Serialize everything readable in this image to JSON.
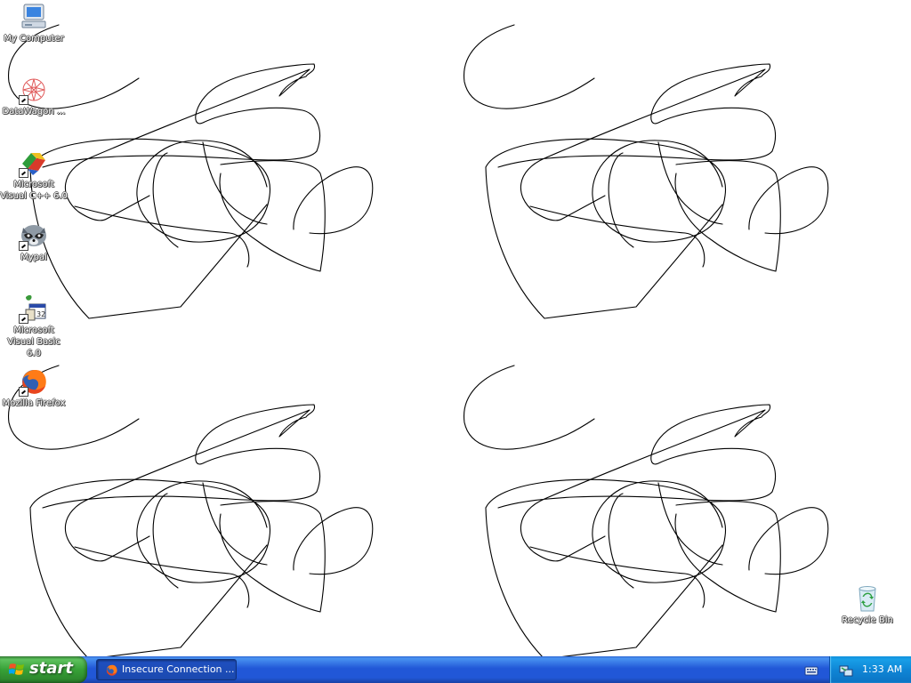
{
  "desktop": {
    "icons": [
      {
        "label": "My Computer",
        "icon": "my-computer-icon"
      },
      {
        "label": "DataWagon ...",
        "icon": "datawagon-icon"
      },
      {
        "label": "Microsoft Visual C++ 6.0",
        "icon": "visual-cpp-icon"
      },
      {
        "label": "Mypal",
        "icon": "mypal-raccoon-icon"
      },
      {
        "label": "Microsoft Visual Basic 6.0",
        "icon": "visual-basic-icon"
      },
      {
        "label": "Mozilla Firefox",
        "icon": "firefox-icon"
      }
    ],
    "recycle_bin": {
      "label": "Recycle Bin",
      "icon": "recycle-bin-icon"
    }
  },
  "taskbar": {
    "start_label": "start",
    "tasks": [
      {
        "label": "Insecure Connection ...",
        "icon": "firefox-icon"
      }
    ],
    "tray": {
      "time": "1:33 AM",
      "icons": [
        "keyboard-icon",
        "network-icon"
      ]
    }
  },
  "colors": {
    "taskbar_blue": "#2157d7",
    "start_green": "#37a137",
    "tray_blue": "#0f86d6",
    "desktop_bg": "#ffffff"
  }
}
